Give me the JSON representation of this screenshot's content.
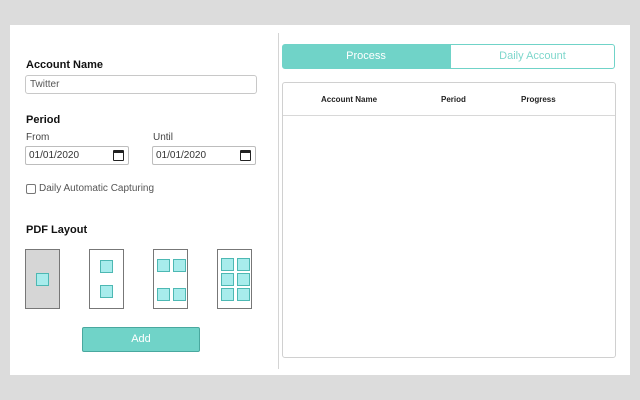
{
  "account": {
    "title": "Account Name",
    "value": "Twitter"
  },
  "period": {
    "title": "Period",
    "from_label": "From",
    "from_value": "01/01/2020",
    "until_label": "Until",
    "until_value": "01/01/2020"
  },
  "daily_capture": {
    "label": "Daily Automatic Capturing",
    "checked": false
  },
  "pdf_layout": {
    "title": "PDF Layout",
    "options": [
      {
        "icon": "layout-1-per-page-icon",
        "selected": true
      },
      {
        "icon": "layout-2-per-page-icon",
        "selected": false
      },
      {
        "icon": "layout-4-per-page-icon",
        "selected": false
      },
      {
        "icon": "layout-6-per-page-icon",
        "selected": false
      }
    ]
  },
  "add_label": "Add",
  "tabs": [
    {
      "label": "Process",
      "active": true
    },
    {
      "label": "Daily Account",
      "active": false
    }
  ],
  "table": {
    "columns": [
      "Account Name",
      "Period",
      "Progress"
    ],
    "rows": []
  },
  "colors": {
    "accent": "#70d3c8",
    "tile_fill": "#a8ecec",
    "tile_border": "#4db8b3"
  }
}
